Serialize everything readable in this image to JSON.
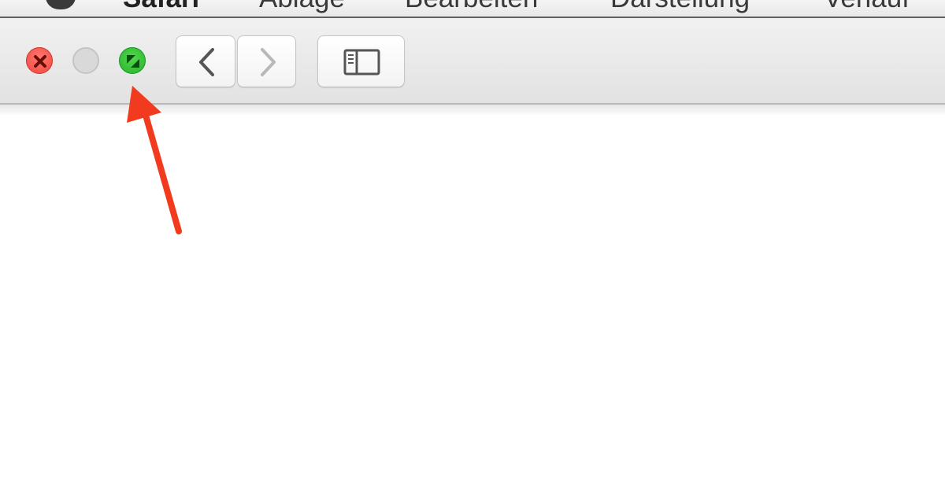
{
  "menubar": {
    "app_name": "Safari",
    "items": [
      "Ablage",
      "Bearbeiten",
      "Darstellung",
      "Verlauf"
    ]
  },
  "toolbar": {
    "traffic_lights": {
      "close_color": "#f0453b",
      "minimize_color": "#d9d9d9",
      "zoom_color": "#27b32c"
    },
    "buttons": {
      "back_icon": "chevron-left-icon",
      "forward_icon": "chevron-right-icon",
      "sidebar_icon": "sidebar-icon"
    }
  },
  "annotation": {
    "arrow_color": "#f23a1f",
    "target": "zoom-button"
  }
}
